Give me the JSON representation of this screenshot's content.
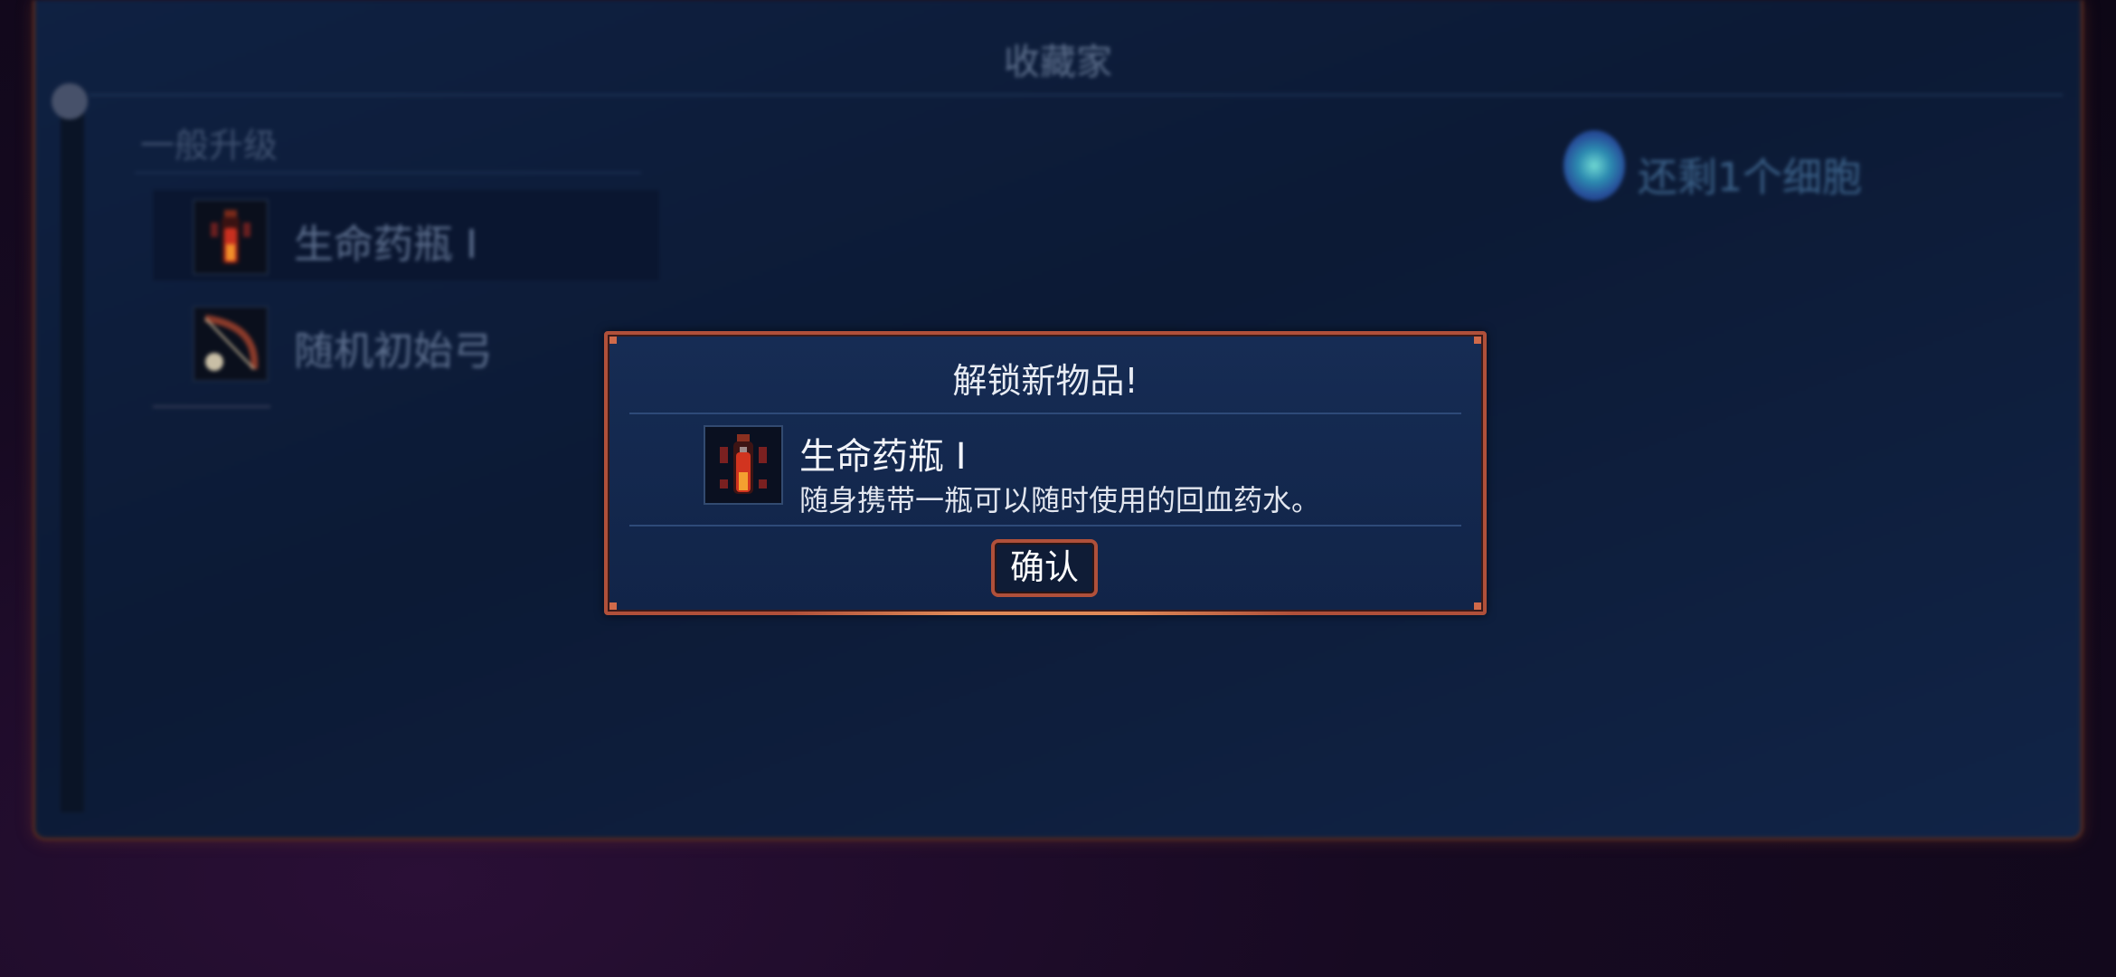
{
  "background_panel": {
    "title": "收藏家",
    "section_heading": "一般升级",
    "items": [
      {
        "label": "生命药瓶 I",
        "icon": "potion-icon"
      },
      {
        "label": "随机初始弓",
        "icon": "bow-icon"
      }
    ],
    "cells_remaining": "还剩1个细胞",
    "cells_icon": "cell-icon"
  },
  "dialog": {
    "title": "解锁新物品!",
    "item_name": "生命药瓶 I",
    "item_description": "随身携带一瓶可以随时使用的回血药水。",
    "item_icon": "health-flask-icon",
    "confirm_label": "确认"
  },
  "colors": {
    "accent_border": "#b0503a",
    "panel_bg": "#112448",
    "text_primary": "#f2f4fa"
  }
}
